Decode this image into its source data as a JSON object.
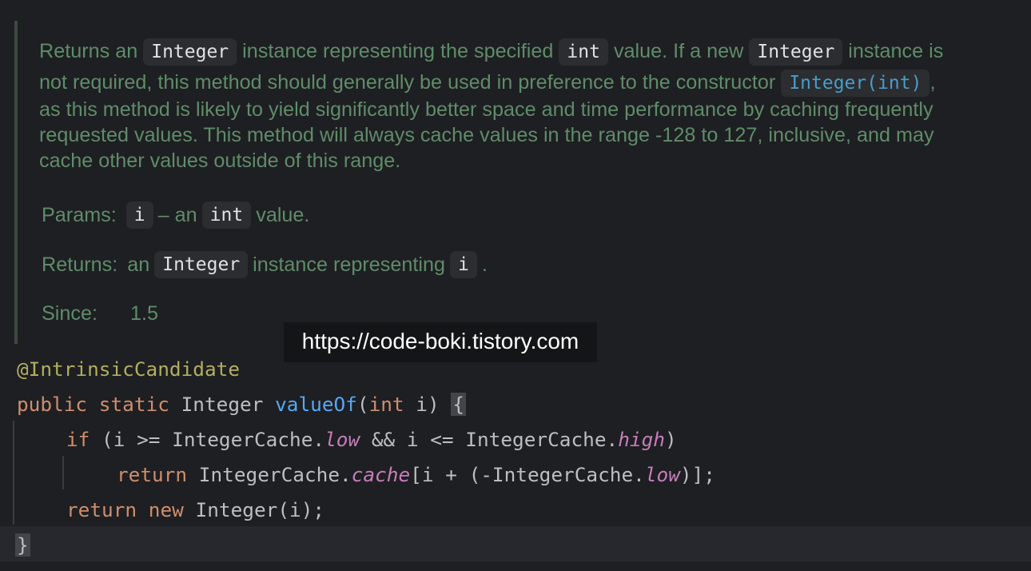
{
  "doc": {
    "line1": {
      "t1": "Returns an ",
      "c1": "Integer",
      "t2": " instance representing the specified ",
      "c2": "int",
      "t3": " value. If a new ",
      "c3": "Integer",
      "t4": " instance is"
    },
    "line2": {
      "t1": "not required, this method should generally be used in preference to the constructor ",
      "link": "Integer(int)",
      "t2": ","
    },
    "line3": "as this method is likely to yield significantly better space and time performance by caching frequently",
    "line4": "requested values. This method will always cache values in the range -128 to 127, inclusive, and may",
    "line5": "cache other values outside of this range.",
    "params": {
      "label": "Params:",
      "name": "i",
      "t1": " – an ",
      "type": "int",
      "t2": " value."
    },
    "returns": {
      "label": "Returns:",
      "t1": "an ",
      "type": "Integer",
      "t2": " instance representing ",
      "var": "i",
      "t3": "."
    },
    "since": {
      "label": "Since:",
      "value": "1.5"
    }
  },
  "watermark": "https://code-boki.tistory.com",
  "code": {
    "annotation": "@IntrinsicCandidate",
    "sig": {
      "kw1": "public",
      "kw2": "static",
      "type": "Integer",
      "name": "valueOf",
      "open": "(",
      "ptype": "int",
      "pname": " i) ",
      "brace": "{"
    },
    "if_line": {
      "kw": "if",
      "a": " (i >= IntegerCache.",
      "f1": "low",
      "b": " && i <= IntegerCache.",
      "f2": "high",
      "c": ")"
    },
    "ret1": {
      "kw": "return",
      "a": " IntegerCache.",
      "f1": "cache",
      "b": "[i + (-IntegerCache.",
      "f2": "low",
      "c": ")];"
    },
    "ret2": {
      "kw1": "return",
      "kw2": "new",
      "a": " Integer(i);"
    },
    "close": "}"
  }
}
